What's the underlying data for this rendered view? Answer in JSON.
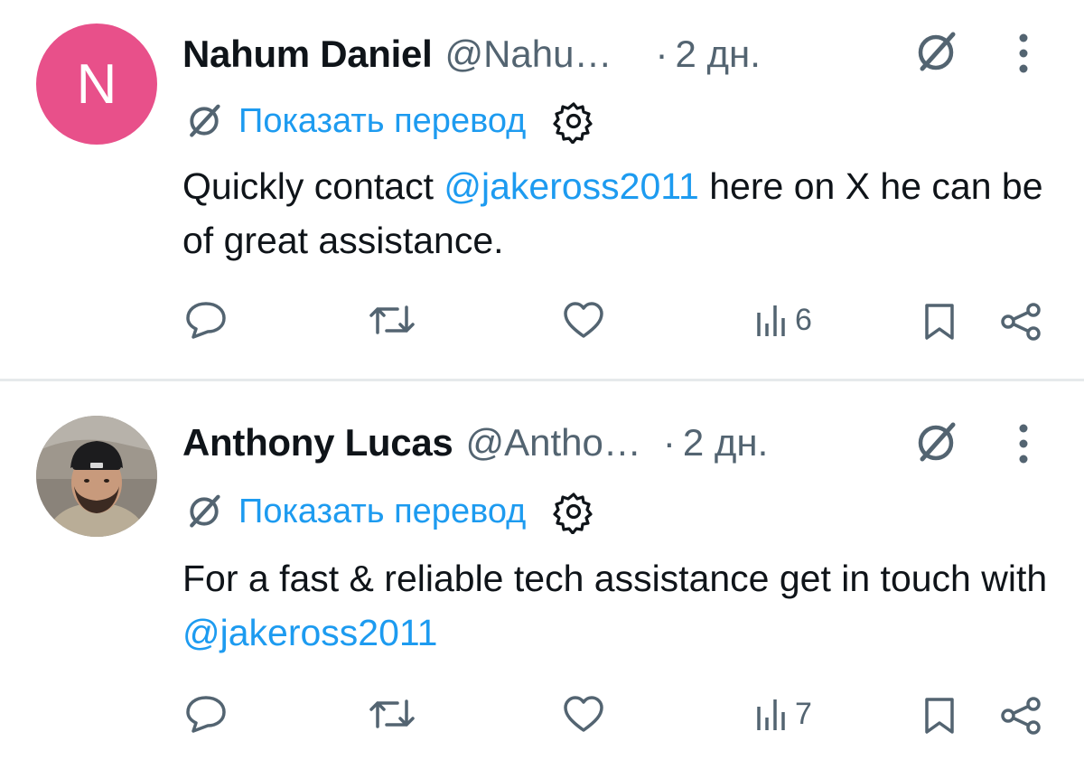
{
  "tweets": [
    {
      "avatar_letter": "N",
      "avatar_color": "#e8508a",
      "name": "Nahum Daniel",
      "handle": "@Nahu…",
      "separator": "·",
      "time": "2 дн.",
      "translate_label": "Показать перевод",
      "text_before": "Quickly contact ",
      "mention": "@jakeross2011",
      "text_after": " here on X he can be of great assistance.",
      "views": "6",
      "icons": [
        "grok-icon",
        "more-icon",
        "translate-icon",
        "settings-icon",
        "reply-icon",
        "repost-icon",
        "like-icon",
        "views-icon",
        "bookmark-icon",
        "share-icon"
      ]
    },
    {
      "name": "Anthony Lucas",
      "handle": "@Antho…",
      "separator": "·",
      "time": "2 дн.",
      "translate_label": "Показать перевод",
      "text_before": "For a fast & reliable tech assistance get in touch with ",
      "mention": "@jakeross2011",
      "text_after": "",
      "views": "7"
    }
  ],
  "colors": {
    "link": "#1d9bf0",
    "secondary": "#536471",
    "text": "#0f1419",
    "divider": "#e6e9eb"
  }
}
